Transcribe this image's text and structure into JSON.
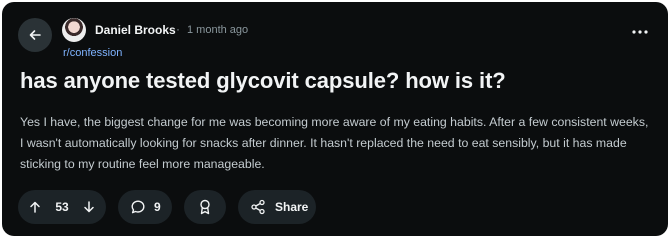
{
  "post": {
    "author": "Daniel Brooks",
    "separator": "·",
    "time": "1 month ago",
    "subreddit": "r/confession",
    "title": "has anyone tested glycovit capsule? how is it?",
    "body": "Yes I have, the biggest change for me was becoming more aware of my eating habits. After a few consistent weeks, I wasn't automatically looking for snacks after dinner. It hasn't replaced the need to eat sensibly, but it has made sticking to my routine feel more manageable."
  },
  "actions": {
    "vote_count": "53",
    "comment_count": "9",
    "share_label": "Share"
  },
  "icons": {
    "back": "arrow-left-icon",
    "more": "more-horizontal-icon",
    "upvote": "arrow-up-icon",
    "downvote": "arrow-down-icon",
    "comment": "comment-bubble-icon",
    "award": "award-icon",
    "share": "share-icon"
  },
  "colors": {
    "background": "#0b0d0e",
    "pill": "#1c2327",
    "link": "#7fb3ff",
    "muted": "#8a979d",
    "text": "#f2f4f5"
  }
}
